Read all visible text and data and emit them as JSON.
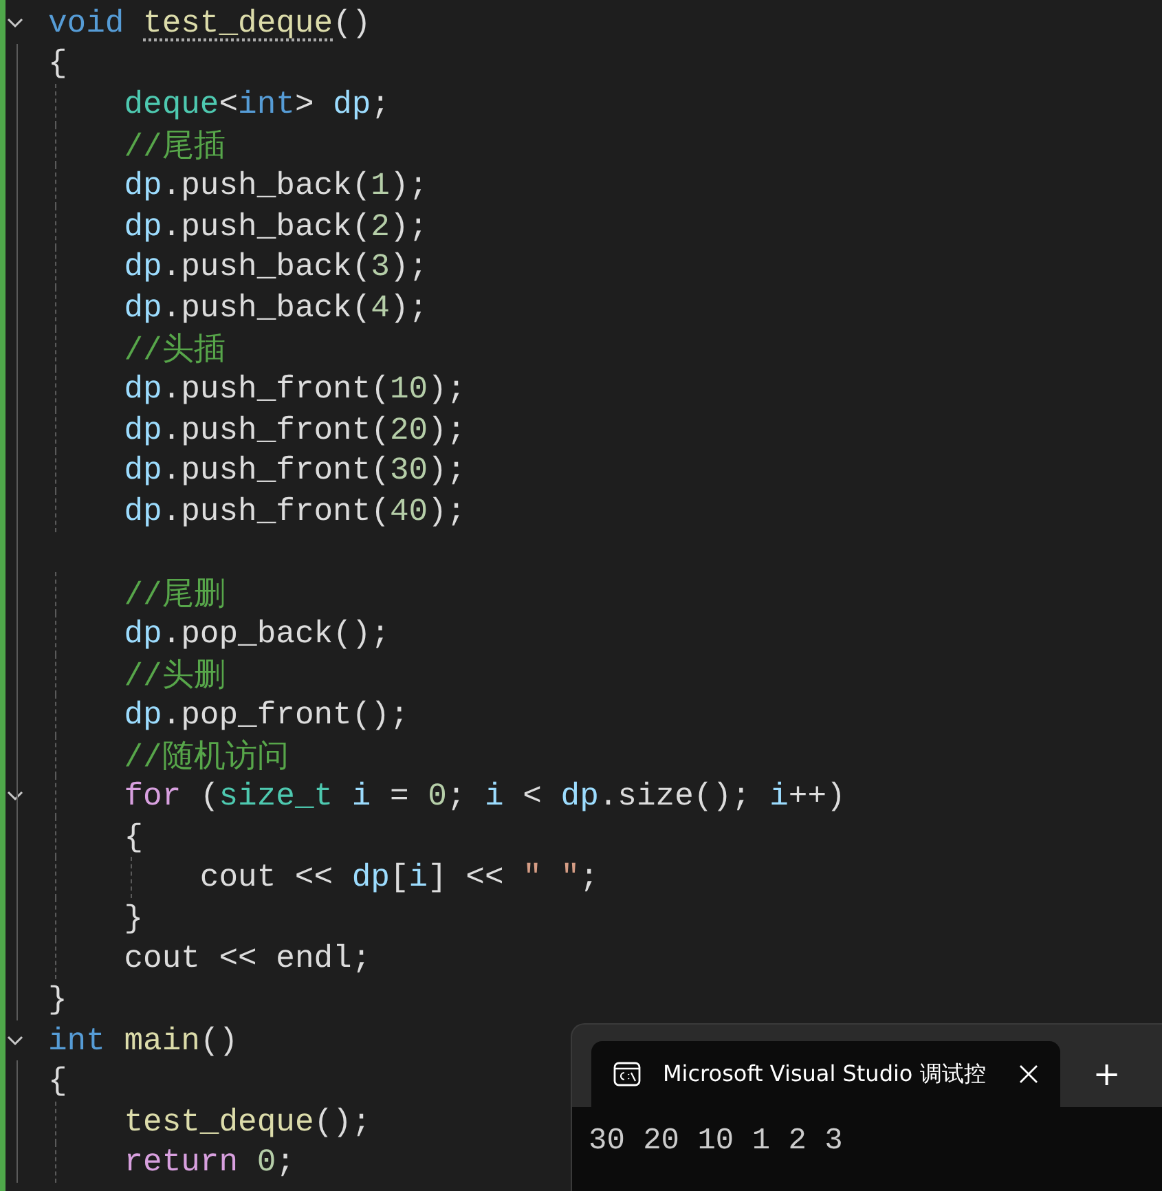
{
  "editor": {
    "lines": [
      {
        "fold": true,
        "tokens": [
          {
            "text": "void ",
            "kind": "keyword"
          },
          {
            "text": "test_deque",
            "kind": "function",
            "hint": true
          },
          {
            "text": "()",
            "kind": "plain"
          }
        ]
      },
      {
        "fold": false,
        "tokens": [
          {
            "text": "{",
            "kind": "plain"
          }
        ]
      },
      {
        "fold": false,
        "tokens": [
          {
            "text": "    deque",
            "kind": "type"
          },
          {
            "text": "<",
            "kind": "plain"
          },
          {
            "text": "int",
            "kind": "keyword"
          },
          {
            "text": "> ",
            "kind": "plain"
          },
          {
            "text": "dp",
            "kind": "variable"
          },
          {
            "text": ";",
            "kind": "plain"
          }
        ]
      },
      {
        "fold": false,
        "tokens": [
          {
            "text": "    //尾插",
            "kind": "comment"
          }
        ]
      },
      {
        "fold": false,
        "tokens": [
          {
            "text": "    dp",
            "kind": "variable"
          },
          {
            "text": ".push_back(",
            "kind": "plain"
          },
          {
            "text": "1",
            "kind": "number"
          },
          {
            "text": ");",
            "kind": "plain"
          }
        ]
      },
      {
        "fold": false,
        "tokens": [
          {
            "text": "    dp",
            "kind": "variable"
          },
          {
            "text": ".push_back(",
            "kind": "plain"
          },
          {
            "text": "2",
            "kind": "number"
          },
          {
            "text": ");",
            "kind": "plain"
          }
        ]
      },
      {
        "fold": false,
        "tokens": [
          {
            "text": "    dp",
            "kind": "variable"
          },
          {
            "text": ".push_back(",
            "kind": "plain"
          },
          {
            "text": "3",
            "kind": "number"
          },
          {
            "text": ");",
            "kind": "plain"
          }
        ]
      },
      {
        "fold": false,
        "tokens": [
          {
            "text": "    dp",
            "kind": "variable"
          },
          {
            "text": ".push_back(",
            "kind": "plain"
          },
          {
            "text": "4",
            "kind": "number"
          },
          {
            "text": ");",
            "kind": "plain"
          }
        ]
      },
      {
        "fold": false,
        "tokens": [
          {
            "text": "    //头插",
            "kind": "comment"
          }
        ]
      },
      {
        "fold": false,
        "tokens": [
          {
            "text": "    dp",
            "kind": "variable"
          },
          {
            "text": ".push_front(",
            "kind": "plain"
          },
          {
            "text": "10",
            "kind": "number"
          },
          {
            "text": ");",
            "kind": "plain"
          }
        ]
      },
      {
        "fold": false,
        "tokens": [
          {
            "text": "    dp",
            "kind": "variable"
          },
          {
            "text": ".push_front(",
            "kind": "plain"
          },
          {
            "text": "20",
            "kind": "number"
          },
          {
            "text": ");",
            "kind": "plain"
          }
        ]
      },
      {
        "fold": false,
        "tokens": [
          {
            "text": "    dp",
            "kind": "variable"
          },
          {
            "text": ".push_front(",
            "kind": "plain"
          },
          {
            "text": "30",
            "kind": "number"
          },
          {
            "text": ");",
            "kind": "plain"
          }
        ]
      },
      {
        "fold": false,
        "tokens": [
          {
            "text": "    dp",
            "kind": "variable"
          },
          {
            "text": ".push_front(",
            "kind": "plain"
          },
          {
            "text": "40",
            "kind": "number"
          },
          {
            "text": ");",
            "kind": "plain"
          }
        ]
      },
      {
        "fold": false
      },
      {
        "fold": false,
        "tokens": [
          {
            "text": "    //尾删",
            "kind": "comment"
          }
        ]
      },
      {
        "fold": false,
        "tokens": [
          {
            "text": "    dp",
            "kind": "variable"
          },
          {
            "text": ".pop_back();",
            "kind": "plain"
          }
        ]
      },
      {
        "fold": false,
        "tokens": [
          {
            "text": "    //头删",
            "kind": "comment"
          }
        ]
      },
      {
        "fold": false,
        "tokens": [
          {
            "text": "    dp",
            "kind": "variable"
          },
          {
            "text": ".pop_front();",
            "kind": "plain"
          }
        ]
      },
      {
        "fold": false,
        "tokens": [
          {
            "text": "    //随机访问",
            "kind": "comment"
          }
        ]
      },
      {
        "fold": true,
        "tokens": [
          {
            "text": "    for",
            "kind": "control"
          },
          {
            "text": " (",
            "kind": "plain"
          },
          {
            "text": "size_t ",
            "kind": "type"
          },
          {
            "text": "i",
            "kind": "variable"
          },
          {
            "text": " = ",
            "kind": "plain"
          },
          {
            "text": "0",
            "kind": "number"
          },
          {
            "text": "; ",
            "kind": "plain"
          },
          {
            "text": "i",
            "kind": "variable"
          },
          {
            "text": " < ",
            "kind": "plain"
          },
          {
            "text": "dp",
            "kind": "variable"
          },
          {
            "text": ".size(); ",
            "kind": "plain"
          },
          {
            "text": "i",
            "kind": "variable"
          },
          {
            "text": "++)",
            "kind": "plain"
          }
        ]
      },
      {
        "fold": false,
        "tokens": [
          {
            "text": "    {",
            "kind": "plain"
          }
        ]
      },
      {
        "fold": false,
        "tokens": [
          {
            "text": "        cout << ",
            "kind": "plain"
          },
          {
            "text": "dp",
            "kind": "variable"
          },
          {
            "text": "[",
            "kind": "plain"
          },
          {
            "text": "i",
            "kind": "variable"
          },
          {
            "text": "] << ",
            "kind": "plain"
          },
          {
            "text": "\" \"",
            "kind": "string"
          },
          {
            "text": ";",
            "kind": "plain"
          }
        ]
      },
      {
        "fold": false,
        "tokens": [
          {
            "text": "    }",
            "kind": "plain"
          }
        ]
      },
      {
        "fold": false,
        "tokens": [
          {
            "text": "    cout << endl;",
            "kind": "plain"
          }
        ]
      },
      {
        "fold": false,
        "tokens": [
          {
            "text": "}",
            "kind": "plain"
          }
        ]
      },
      {
        "fold": true,
        "tokens": [
          {
            "text": "int ",
            "kind": "keyword"
          },
          {
            "text": "main",
            "kind": "function"
          },
          {
            "text": "()",
            "kind": "plain"
          }
        ]
      },
      {
        "fold": false,
        "tokens": [
          {
            "text": "{",
            "kind": "plain"
          }
        ]
      },
      {
        "fold": false,
        "tokens": [
          {
            "text": "    test_deque",
            "kind": "function"
          },
          {
            "text": "();",
            "kind": "plain"
          }
        ]
      },
      {
        "fold": false,
        "tokens": [
          {
            "text": "    return ",
            "kind": "control"
          },
          {
            "text": "0",
            "kind": "number"
          },
          {
            "text": ";",
            "kind": "plain"
          }
        ]
      }
    ]
  },
  "terminal": {
    "tabs": [
      {
        "title": "Microsoft Visual Studio 调试控",
        "selected": true
      }
    ],
    "new_tab": "+",
    "output": [
      "30 20 10 1 2 3"
    ]
  }
}
